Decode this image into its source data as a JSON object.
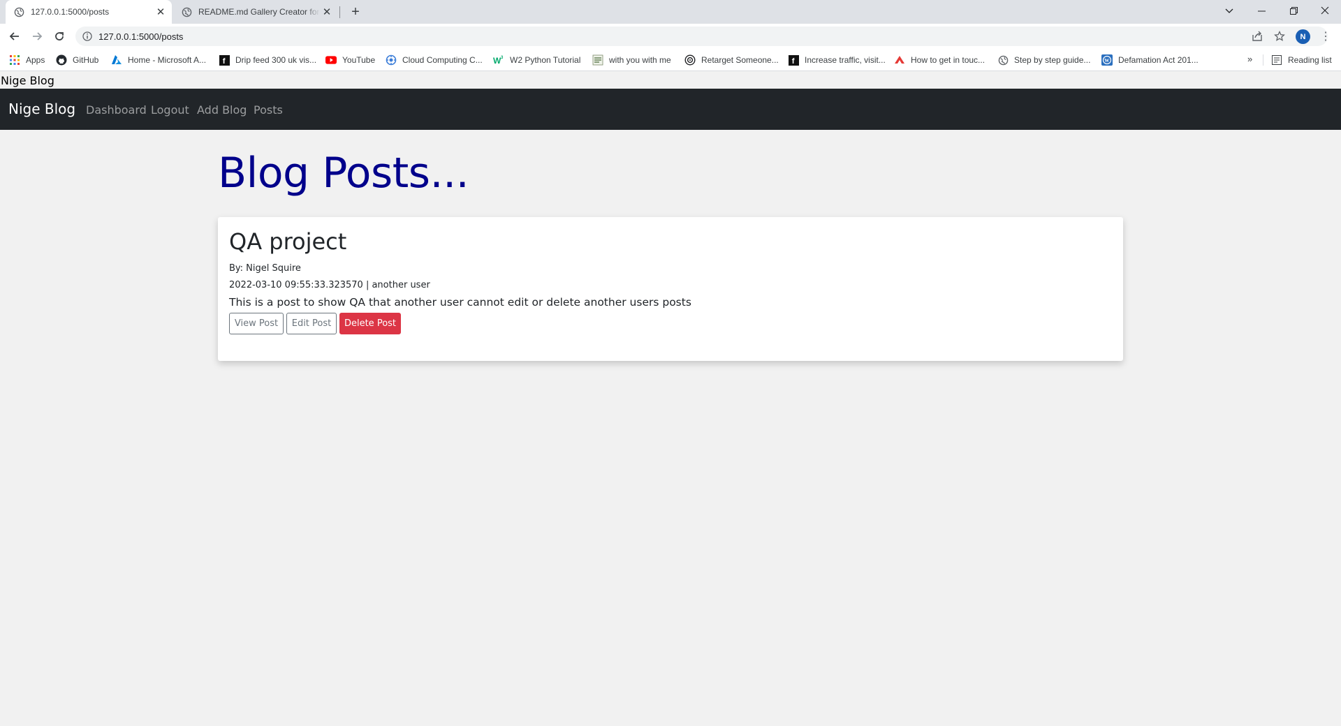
{
  "browser": {
    "tabs": [
      {
        "title": "127.0.0.1:5000/posts",
        "active": true
      },
      {
        "title": "README.md Gallery Creator for GitHub",
        "active": false
      }
    ],
    "url": "127.0.0.1:5000/posts",
    "profile_initial": "N",
    "bookmarks": [
      {
        "label": "Apps",
        "icon": "apps-grid-icon"
      },
      {
        "label": "GitHub",
        "icon": "github-icon"
      },
      {
        "label": "Home - Microsoft A...",
        "icon": "azure-icon"
      },
      {
        "label": "Drip feed 300 uk vis...",
        "icon": "fiverr-icon"
      },
      {
        "label": "YouTube",
        "icon": "youtube-icon"
      },
      {
        "label": "Cloud Computing C...",
        "icon": "cloud-icon"
      },
      {
        "label": "W2 Python Tutorial",
        "icon": "w3-icon"
      },
      {
        "label": "with you with me",
        "icon": "site-icon"
      },
      {
        "label": "Retarget Someone...",
        "icon": "target-icon"
      },
      {
        "label": "Increase traffic, visit...",
        "icon": "fiverr-icon"
      },
      {
        "label": "How to get in touc...",
        "icon": "arrow-logo-icon"
      },
      {
        "label": "Step by step guide...",
        "icon": "globe-icon"
      },
      {
        "label": "Defamation Act 201...",
        "icon": "wordpress-icon"
      }
    ],
    "more_bookmarks": "»",
    "reading_list": "Reading list",
    "colors": {
      "tabstrip": "#dee1e6",
      "toolbar": "#ffffff",
      "avatar": "#1a5fb4"
    }
  },
  "page": {
    "top_text": "Nige Blog",
    "navbar": {
      "brand": "Nige Blog",
      "links": [
        "Dashboard",
        "Logout",
        "Add Blog",
        "Posts"
      ]
    },
    "heading": "Blog Posts...",
    "posts": [
      {
        "title": "QA project",
        "author": "By: Nigel Squire",
        "meta": "2022-03-10 09:55:33.323570 | another user",
        "body": "This is a post to show QA that another user cannot edit or delete another users posts",
        "buttons": {
          "view": "View Post",
          "edit": "Edit Post",
          "delete": "Delete Post"
        }
      }
    ],
    "colors": {
      "navbar": "#212529",
      "heading": "#00008b",
      "danger": "#dc3545",
      "background": "#f1f1f1"
    }
  }
}
